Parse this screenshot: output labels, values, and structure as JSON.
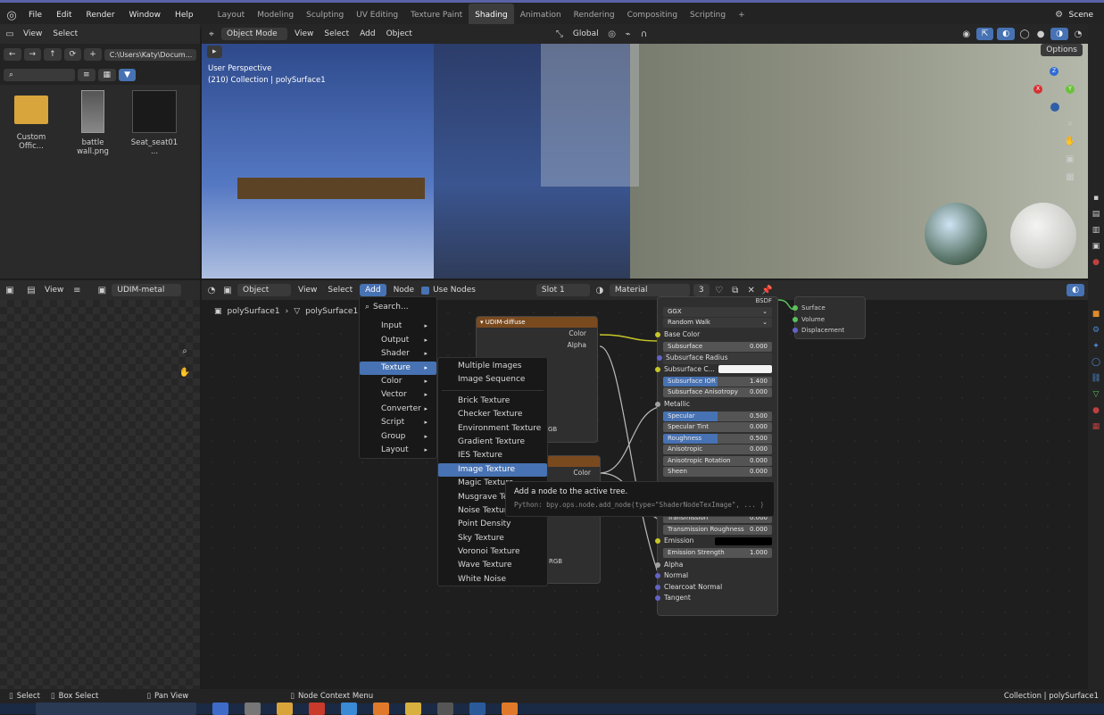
{
  "menubar": {
    "items": [
      "File",
      "Edit",
      "Render",
      "Window",
      "Help"
    ],
    "workspaces": [
      "Layout",
      "Modeling",
      "Sculpting",
      "UV Editing",
      "Texture Paint",
      "Shading",
      "Animation",
      "Rendering",
      "Compositing",
      "Scripting"
    ],
    "add_tab": "+",
    "scene": "Scene"
  },
  "file_browser": {
    "view": "View",
    "select": "Select",
    "path": "C:\\Users\\Katy\\Docum...",
    "files": [
      {
        "name": "Custom Offic...",
        "kind": "folder"
      },
      {
        "name": "battle wall.png",
        "kind": "image"
      },
      {
        "name": "Seat_seat01 ...",
        "kind": "image"
      }
    ]
  },
  "viewport": {
    "mode": "Object Mode",
    "view": "View",
    "select": "Select",
    "add": "Add",
    "object": "Object",
    "orientation": "Global",
    "perspective": "User Perspective",
    "collection": "(210) Collection | polySurface1",
    "options": "Options",
    "gizmo": {
      "x": "X",
      "y": "Y",
      "z": "Z"
    }
  },
  "image_editor": {
    "view": "View",
    "image_name": "UDIM-metal"
  },
  "node_editor": {
    "header": {
      "object": "Object",
      "view": "View",
      "select": "Select",
      "add": "Add",
      "node": "Node",
      "use_nodes": "Use Nodes",
      "slot": "Slot 1",
      "material": "Material",
      "users": "3"
    },
    "breadcrumb": [
      "polySurface1",
      "polySurface1"
    ]
  },
  "add_menu": {
    "search": "Search...",
    "items": [
      "Input",
      "Output",
      "Shader",
      "Texture",
      "Color",
      "Vector",
      "Converter",
      "Script",
      "Group",
      "Layout"
    ],
    "active": "Texture"
  },
  "texture_menu": {
    "items": [
      "Multiple Images",
      "Image Sequence",
      "Brick Texture",
      "Checker Texture",
      "Environment Texture",
      "Gradient Texture",
      "IES Texture",
      "Image Texture",
      "Magic Texture",
      "Musgrave Tex",
      "Noise Texture",
      "Point Density",
      "Sky Texture",
      "Voronoi Texture",
      "Wave Texture",
      "White Noise"
    ],
    "active": "Image Texture"
  },
  "tooltip": {
    "title": "Add a node to the active tree.",
    "python": "Python: bpy.ops.node.add_node(type=\"ShaderNodeTexImage\", ... )"
  },
  "udim_node": {
    "title": "UDIM-diffuse",
    "outputs": [
      "Color",
      "Alpha"
    ],
    "rgb1": "GB",
    "rgb2": "RGB",
    "color2": "Color"
  },
  "bsdf": {
    "title": "BSDF",
    "dist": "GGX",
    "ss_method": "Random Walk",
    "rows": [
      {
        "label": "Base Color",
        "type": "socket",
        "sock": "#c7c729"
      },
      {
        "label": "Subsurface",
        "type": "field",
        "value": "0.000",
        "fill": 0
      },
      {
        "label": "Subsurface Radius",
        "type": "select",
        "sock": "#6363c7"
      },
      {
        "label": "Subsurface C...",
        "type": "color",
        "sock": "#c7c729"
      },
      {
        "label": "Subsurface IOR",
        "type": "field",
        "value": "1.400",
        "fill": 0.5
      },
      {
        "label": "Subsurface Anisotropy",
        "type": "field",
        "value": "0.000",
        "fill": 0
      },
      {
        "label": "Metallic",
        "type": "socket",
        "sock": "#a1a1a1"
      },
      {
        "label": "Specular",
        "type": "field",
        "value": "0.500",
        "fill": 0.5
      },
      {
        "label": "Specular Tint",
        "type": "field",
        "value": "0.000",
        "fill": 0
      },
      {
        "label": "Roughness",
        "type": "field",
        "value": "0.500",
        "fill": 0.5
      },
      {
        "label": "Anisotropic",
        "type": "field",
        "value": "0.000",
        "fill": 0
      },
      {
        "label": "Anisotropic Rotation",
        "type": "field",
        "value": "0.000",
        "fill": 0
      },
      {
        "label": "Sheen",
        "type": "field",
        "value": "0.000",
        "fill": 0
      }
    ],
    "rows2": [
      {
        "label": "Transmission",
        "type": "field",
        "value": "0.000",
        "fill": 0
      },
      {
        "label": "Transmission Roughness",
        "type": "field",
        "value": "0.000",
        "fill": 0
      },
      {
        "label": "Emission",
        "type": "emission",
        "sock": "#c7c729"
      },
      {
        "label": "Emission Strength",
        "type": "field",
        "value": "1.000",
        "fill": 0
      },
      {
        "label": "Alpha",
        "type": "socket",
        "sock": "#a1a1a1"
      },
      {
        "label": "Normal",
        "type": "socket",
        "sock": "#6363c7"
      },
      {
        "label": "Clearcoat Normal",
        "type": "socket",
        "sock": "#6363c7"
      },
      {
        "label": "Tangent",
        "type": "socket",
        "sock": "#6363c7"
      }
    ]
  },
  "output_node": {
    "inputs": [
      "Surface",
      "Volume",
      "Displacement"
    ]
  },
  "statusbar": {
    "select": "Select",
    "box_select": "Box Select",
    "pan_view": "Pan View",
    "context": "Node Context Menu",
    "right": "Collection | polySurface1"
  },
  "colors": {
    "accent": "#4772b3",
    "header": "#2b2b2b",
    "menu": "#181818",
    "udim_header": "#7a4a1f"
  }
}
